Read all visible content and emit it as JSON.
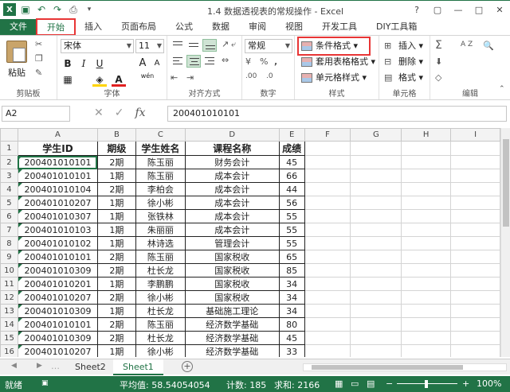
{
  "window": {
    "title": "1.4 数据透视表的常规操作 - Excel",
    "controls": [
      "?",
      "▢",
      "—",
      "□",
      "✕"
    ]
  },
  "ribbon_tabs": [
    "文件",
    "开始",
    "插入",
    "页面布局",
    "公式",
    "数据",
    "审阅",
    "视图",
    "开发工具",
    "DIY工具箱"
  ],
  "ribbon": {
    "clipboard": {
      "paste": "粘贴",
      "label": "剪贴板"
    },
    "font": {
      "name": "宋体",
      "size": "11",
      "bold": "B",
      "italic": "I",
      "underline": "U",
      "grow": "A",
      "shrink": "A",
      "phonetic": "wén",
      "label": "字体"
    },
    "alignment": {
      "label": "对齐方式"
    },
    "number": {
      "format": "常规",
      "label": "数字",
      "percent": "%",
      "comma": ",",
      "inc": ".00",
      "dec": ".0"
    },
    "styles": {
      "conditional": "条件格式",
      "table": "套用表格格式",
      "cell": "单元格样式",
      "label": "样式"
    },
    "cells": {
      "insert": "插入",
      "delete": "删除",
      "format": "格式",
      "label": "单元格"
    },
    "editing": {
      "label": "编辑",
      "sum": "Σ",
      "sort": "A Z",
      "find": "🔍"
    }
  },
  "formula_bar": {
    "name_box": "A2",
    "fx": "fx",
    "value": "200401010101"
  },
  "columns": [
    "A",
    "B",
    "C",
    "D",
    "E",
    "F",
    "G",
    "H",
    "I"
  ],
  "header_row": [
    "学生ID",
    "期级",
    "学生姓名",
    "课程名称",
    "成绩"
  ],
  "rows": [
    [
      "200401010101",
      "2期",
      "陈玉丽",
      "财务会计",
      "45"
    ],
    [
      "200401010101",
      "1期",
      "陈玉丽",
      "成本会计",
      "66"
    ],
    [
      "200401010104",
      "2期",
      "李柏会",
      "成本会计",
      "44"
    ],
    [
      "200401010207",
      "1期",
      "徐小彬",
      "成本会计",
      "56"
    ],
    [
      "200401010307",
      "1期",
      "张铁林",
      "成本会计",
      "55"
    ],
    [
      "200401010103",
      "1期",
      "朱丽丽",
      "成本会计",
      "55"
    ],
    [
      "200401010102",
      "1期",
      "林诗选",
      "管理会计",
      "55"
    ],
    [
      "200401010101",
      "2期",
      "陈玉丽",
      "国家税收",
      "65"
    ],
    [
      "200401010309",
      "2期",
      "杜长龙",
      "国家税收",
      "85"
    ],
    [
      "200401010201",
      "1期",
      "李鹏鹏",
      "国家税收",
      "34"
    ],
    [
      "200401010207",
      "2期",
      "徐小彬",
      "国家税收",
      "34"
    ],
    [
      "200401010309",
      "1期",
      "杜长龙",
      "基础施工理论",
      "34"
    ],
    [
      "200401010101",
      "2期",
      "陈玉丽",
      "经济数学基础",
      "80"
    ],
    [
      "200401010309",
      "2期",
      "杜长龙",
      "经济数学基础",
      "45"
    ],
    [
      "200401010207",
      "1期",
      "徐小彬",
      "经济数学基础",
      "33"
    ]
  ],
  "sheet_tabs": [
    "Sheet2",
    "Sheet1"
  ],
  "active_sheet": "Sheet1",
  "status": {
    "ready": "就绪",
    "average": "平均值: 58.54054054",
    "count": "计数: 185",
    "sum": "求和: 2166",
    "zoom": "100%"
  },
  "colors": {
    "accent": "#217346",
    "highlight": "#e83535"
  }
}
